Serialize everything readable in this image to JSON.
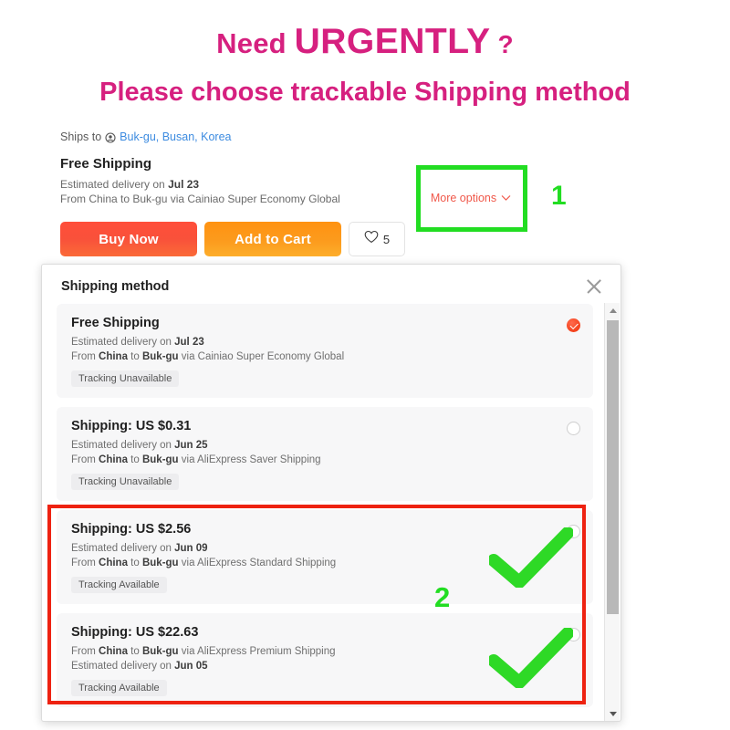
{
  "promo": {
    "line1_pre": "Need ",
    "line1_big": "URGENTLY",
    "line1_post": " ?",
    "line2": "Please choose trackable Shipping method",
    "color": "#D6207F"
  },
  "product": {
    "ships_to_label": "Ships to",
    "ships_to_icon": "location-pin-icon",
    "destination": "Buk-gu, Busan, Korea",
    "shipping_title": "Free Shipping",
    "eta_prefix": "Estimated delivery on ",
    "eta": "Jul 23",
    "route": "From China to Buk-gu via Cainiao Super Economy Global",
    "route_from": "China",
    "route_to": "Buk-gu",
    "route_carrier": "Cainiao Super Economy Global",
    "buy_now_label": "Buy Now",
    "add_to_cart_label": "Add to Cart",
    "wishlist_icon": "heart-icon",
    "wishlist_count": "5",
    "more_options_label": "More options",
    "more_options_icon": "chevron-down-icon"
  },
  "annotations": {
    "step1": "1",
    "step2": "2",
    "step1_color": "#22DD22",
    "step2_color": "#22DD22",
    "highlight_box_color": "#EE2211",
    "check_color": "#2ED926"
  },
  "dialog": {
    "title": "Shipping method",
    "close_icon": "close-icon",
    "scrollbar": {
      "up_icon": "triangle-up-icon",
      "down_icon": "triangle-down-icon"
    },
    "options": [
      {
        "price": "Free Shipping",
        "eta_prefix": "Estimated delivery on ",
        "eta": "Jul 23",
        "route_prefix": "From ",
        "route_from": "China",
        "route_mid": " to ",
        "route_to": "Buk-gu",
        "route_suffix": " via Cainiao Super Economy Global",
        "tracking": "Tracking Unavailable",
        "selected": true,
        "order": "eta_first"
      },
      {
        "price": "Shipping: US $0.31",
        "eta_prefix": "Estimated delivery on ",
        "eta": "Jun 25",
        "route_prefix": "From ",
        "route_from": "China",
        "route_mid": " to ",
        "route_to": "Buk-gu",
        "route_suffix": " via AliExpress Saver Shipping",
        "tracking": "Tracking Unavailable",
        "selected": false,
        "order": "eta_first"
      },
      {
        "price": "Shipping: US $2.56",
        "eta_prefix": "Estimated delivery on ",
        "eta": "Jun 09",
        "route_prefix": "From ",
        "route_from": "China",
        "route_mid": " to ",
        "route_to": "Buk-gu",
        "route_suffix": " via AliExpress Standard Shipping",
        "tracking": "Tracking Available",
        "selected": false,
        "order": "eta_first"
      },
      {
        "price": "Shipping: US $22.63",
        "eta_prefix": "Estimated delivery on ",
        "eta": "Jun 05",
        "route_prefix": "From ",
        "route_from": "China",
        "route_mid": " to ",
        "route_to": "Buk-gu",
        "route_suffix": " via AliExpress Premium Shipping",
        "tracking": "Tracking Available",
        "selected": false,
        "order": "route_first"
      }
    ]
  }
}
